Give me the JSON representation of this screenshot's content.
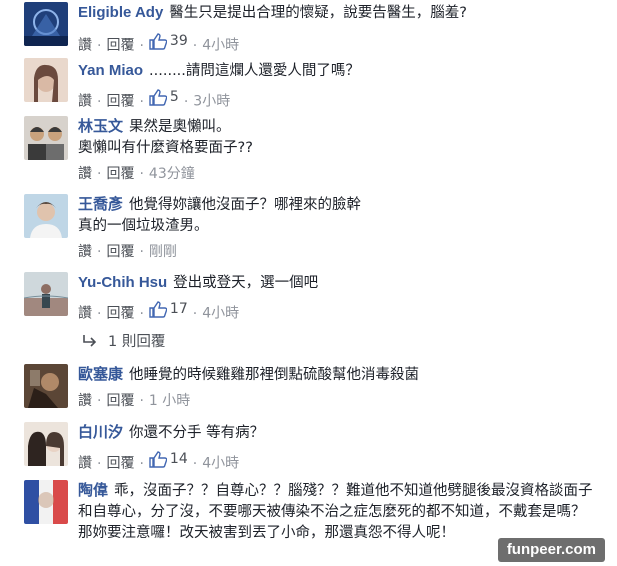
{
  "ui": {
    "read_label": "讚",
    "reply_label": "回覆",
    "separator": "·"
  },
  "comments": [
    {
      "author": "Eligible Ady",
      "text": "醫生只是提出合理的懷疑，說要告醫生，腦羞?",
      "likes": "39",
      "time": "4小時",
      "avatar_colors": [
        "#1f3f7a",
        "#4a78c2"
      ]
    },
    {
      "author": "Yan Miao",
      "text": "........請問這爛人還愛人間了嗎？",
      "likes": "5",
      "time": "3小時",
      "avatar_colors": [
        "#d9b9a5",
        "#6b4a3e"
      ]
    },
    {
      "author": "林玉文",
      "text": "果然是奧懶叫。\n奧懶叫有什麼資格要面子??",
      "likes": "",
      "time": "43分鐘",
      "avatar_colors": [
        "#3a3a3a",
        "#c9a27d"
      ]
    },
    {
      "author": "王喬彥",
      "text": "他覺得妳讓他沒面子？哪裡來的臉幹\n真的一個垃圾渣男。",
      "likes": "",
      "time": "剛剛",
      "avatar_colors": [
        "#bfd6e6",
        "#5a4a40"
      ]
    },
    {
      "author": "Yu-Chih Hsu",
      "text": "登出或登天，選一個吧",
      "likes": "17",
      "time": "4小時",
      "avatar_colors": [
        "#cfd8dc",
        "#8d6e63"
      ]
    },
    {
      "author": "歐塞康",
      "text": "他睡覺的時候雞雞那裡倒點硫酸幫他消毒殺菌",
      "likes": "",
      "time": "1 小時",
      "avatar_colors": [
        "#5b4636",
        "#b08968"
      ]
    },
    {
      "author": "白川汐",
      "text": "你還不分手 等有病？",
      "likes": "14",
      "time": "4小時",
      "avatar_colors": [
        "#e8d3c5",
        "#2e2420"
      ]
    },
    {
      "author": "陶偉",
      "text": "乖，沒面子？？自尊心？？腦殘？？難道他不知道他劈腿後最沒資格談面子和自尊心，分了沒，不要哪天被傳染不治之症怎麼死的都不知道，不戴套是嗎？那妳要注意囉！改天被害到丟了小命，那還真怨不得人呢！",
      "likes": "",
      "time": "",
      "avatar_colors": [
        "#2f4fa3",
        "#d94a4a"
      ]
    }
  ],
  "replies_label": "1 則回覆",
  "watermark": "funpeer.com"
}
